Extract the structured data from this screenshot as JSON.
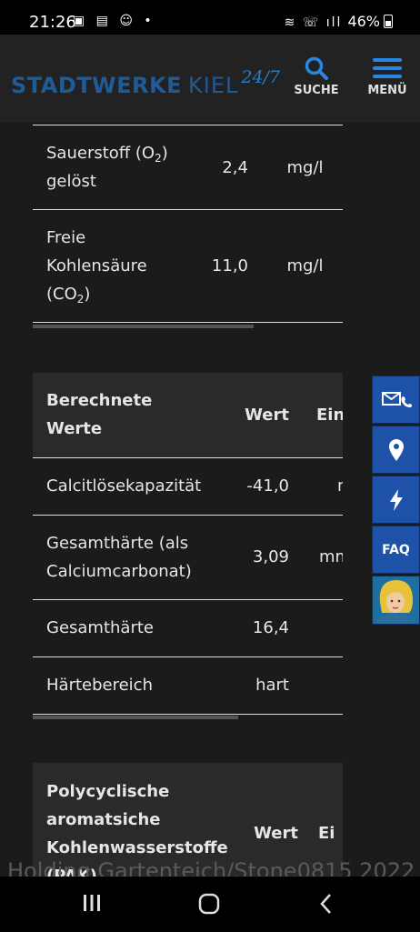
{
  "status_bar": {
    "time": "21:26",
    "battery": "46%"
  },
  "header": {
    "logo_main": "STADTWERKE",
    "logo_city": "KIEL",
    "logo_tag": "24/7",
    "search_label": "SUCHE",
    "menu_label": "MENÜ",
    "logo_color": "#1f5b96"
  },
  "table1": {
    "rows": [
      {
        "label_line1": "Sauerstoff (O",
        "label_sub": "2",
        "label_after": ")",
        "label_line2": "gelöst",
        "value": "2,4",
        "unit": "mg/l"
      },
      {
        "label_line1": "Freie",
        "label_line2": "Kohlensäure",
        "label_line3_pre": "(CO",
        "label_sub": "2",
        "label_after": ")",
        "value": "11,0",
        "unit": "mg/l"
      }
    ]
  },
  "table2": {
    "header": {
      "col1_line1": "Berechnete",
      "col1_line2": "Werte",
      "col2": "Wert",
      "col3": "Einh"
    },
    "rows": [
      {
        "label_line1": "Calcitlösekapazität",
        "label_line2": "",
        "value": "-41,0",
        "unit": "m"
      },
      {
        "label_line1": "Gesamthärte (als",
        "label_line2": "Calciumcarbonat)",
        "value": "3,09",
        "unit": "mmo"
      },
      {
        "label_line1": "Gesamthärte",
        "label_line2": "",
        "value": "16,4",
        "unit": "°"
      },
      {
        "label_line1": "Härtebereich",
        "label_line2": "",
        "value": "hart",
        "unit": ""
      }
    ]
  },
  "table3": {
    "header": {
      "col1_line1": "Polycyclische",
      "col1_line2": "aromatsiche",
      "col1_line3": "Kohlenwasserstoffe",
      "col1_line4": "(PAK)",
      "col2": "Wert",
      "col3": "Ei"
    }
  },
  "side_tabs": {
    "faq_label": "FAQ",
    "accent_color": "#1d52a8"
  },
  "watermark": "Holding Gartenteich/Stone0815 2022"
}
